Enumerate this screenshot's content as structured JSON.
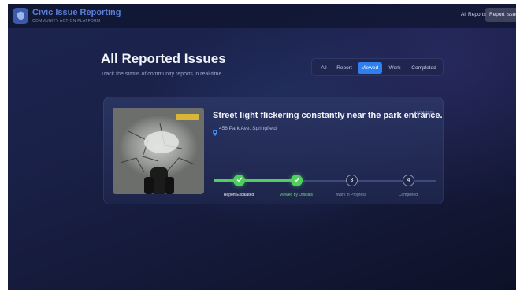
{
  "app": {
    "title": "Civic Issue Reporting",
    "subtitle": "COMMUNITY ACTION PLATFORM",
    "logo_icon": "shield-icon"
  },
  "nav": {
    "all_reports": "All Reports",
    "report_issue": "Report Issue"
  },
  "page": {
    "title": "All Reported Issues",
    "subtitle": "Track the status of community reports in real-time"
  },
  "filters": {
    "tabs": [
      "All",
      "Report",
      "Viewed",
      "Work",
      "Completed"
    ],
    "active": "Viewed"
  },
  "issue": {
    "title": "Street light flickering constantly near the park entrance.",
    "date": "10/24/2025",
    "location": "456 Park Ave, Springfield",
    "location_icon": "location-pin-icon",
    "steps": [
      {
        "marker": "check-icon",
        "label": "Report Escalated",
        "state": "done"
      },
      {
        "marker": "check-icon",
        "label": "Viewed by Officials",
        "state": "current"
      },
      {
        "marker": "3",
        "label": "Work in Progress",
        "state": "pending"
      },
      {
        "marker": "4",
        "label": "Completed",
        "state": "pending"
      }
    ]
  },
  "colors": {
    "accent": "#2f7ff0",
    "success": "#4fcf5d",
    "background": "#1a2148"
  }
}
